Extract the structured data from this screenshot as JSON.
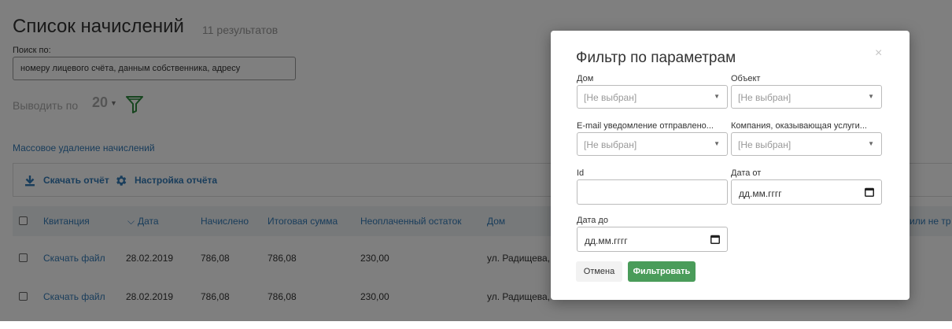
{
  "page": {
    "title": "Список начислений",
    "results_count": "11 результатов",
    "search": {
      "label": "Поиск по:",
      "placeholder": "номеру лицевого счёта, данным собственника, адресу"
    },
    "per_page": {
      "label": "Выводить по",
      "value": "20"
    },
    "mass_delete": "Массовое удаление начислений",
    "toolbar": {
      "download_report": "Скачать отчёт",
      "report_settings": "Настройка отчёта"
    },
    "table": {
      "columns": [
        "Квитанция",
        "Дата",
        "Начислено",
        "Итоговая сумма",
        "Неоплаченный остаток",
        "Дом",
        "или не тр"
      ],
      "rows": [
        {
          "receipt": "Скачать файл",
          "date": "28.02.2019",
          "accrued": "786,08",
          "total": "786,08",
          "unpaid": "230,00",
          "house": "ул. Радищева,"
        },
        {
          "receipt": "Скачать файл",
          "date": "28.02.2019",
          "accrued": "786,08",
          "total": "786,08",
          "unpaid": "230,00",
          "house": "ул. Радищева,"
        }
      ]
    }
  },
  "modal": {
    "title": "Фильтр по параметрам",
    "close": "×",
    "fields": {
      "house": {
        "label": "Дом",
        "value": "[Не выбран]"
      },
      "object": {
        "label": "Объект",
        "value": "[Не выбран]"
      },
      "email": {
        "label": "E-mail уведомление отправлено...",
        "value": "[Не выбран]"
      },
      "company": {
        "label": "Компания, оказывающая услуги...",
        "value": "[Не выбран]"
      },
      "id": {
        "label": "Id",
        "value": ""
      },
      "date_from": {
        "label": "Дата от",
        "value": "дд.мм.гггг"
      },
      "date_to": {
        "label": "Дата до",
        "value": "дд.мм.гггг"
      }
    },
    "cancel": "Отмена",
    "submit": "Фильтровать"
  },
  "colors": {
    "link": "#337ab7",
    "primary_button": "#4a9c5a",
    "filter_icon": "#2e8b3e",
    "overlay": "rgba(0,0,0,0.5)"
  }
}
